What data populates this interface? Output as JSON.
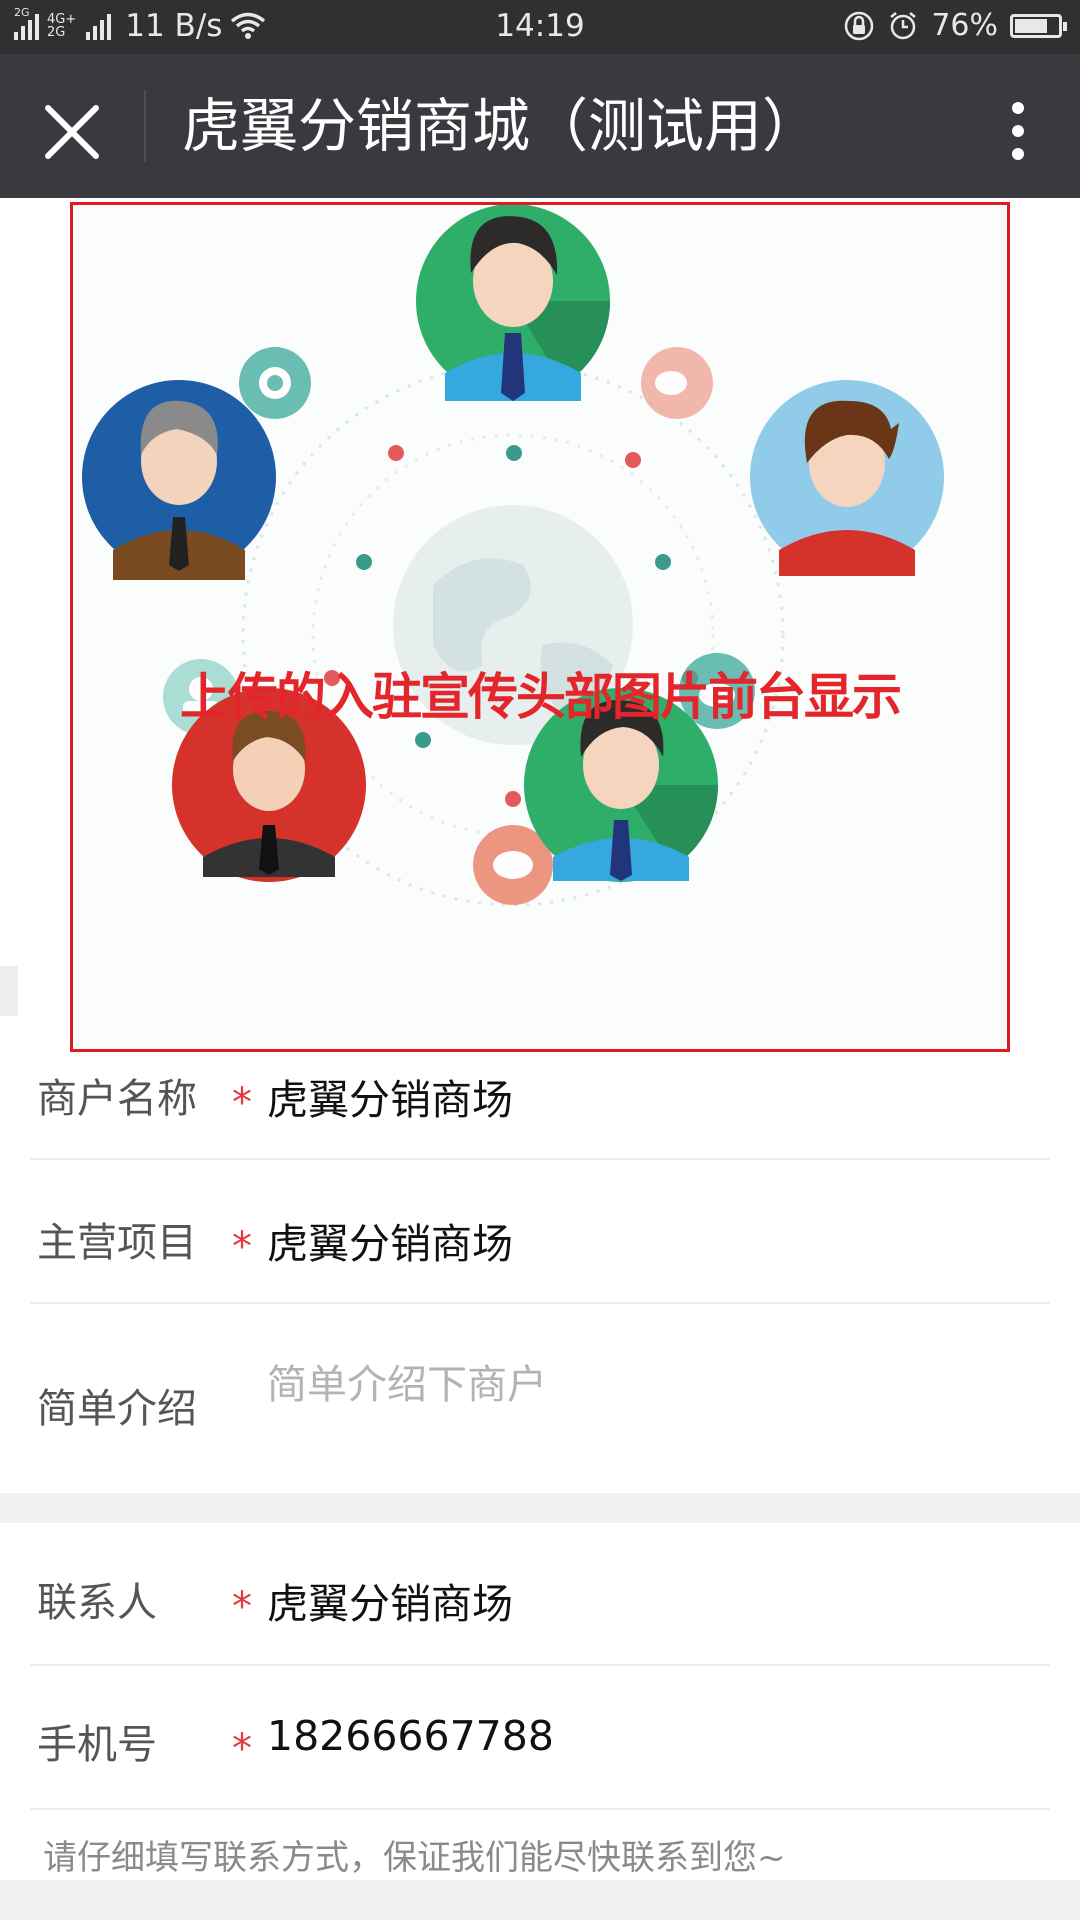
{
  "status_bar": {
    "net_top": "4G+",
    "net_bottom": "2G",
    "sig_left": "2G",
    "speed": "11 B/s",
    "time": "14:19",
    "battery": "76%",
    "battery_level": 0.76,
    "icons": [
      "signal-icon",
      "wifi-icon",
      "rotation-lock-icon",
      "alarm-icon",
      "battery-icon"
    ]
  },
  "nav": {
    "title": "虎翼分销商城（测试用）",
    "icons": [
      "close-icon",
      "more-icon"
    ]
  },
  "banner": {
    "caption": "上传的入驻宣传头部图片前台显示",
    "border_color": "#e11b22"
  },
  "form": {
    "merchant_name_label": "商户名称",
    "merchant_name_value": "虎翼分销商场",
    "main_business_label": "主营项目",
    "main_business_value": "虎翼分销商场",
    "intro_label": "简单介绍",
    "intro_placeholder": "简单介绍下商户",
    "contact_label": "联系人",
    "contact_value": "虎翼分销商场",
    "phone_label": "手机号",
    "phone_value": "18266667788",
    "required_mark": "*",
    "hint": "请仔细填写联系方式，保证我们能尽快联系到您~"
  },
  "colors": {
    "status_bar": "#2e3032",
    "nav_bar": "#393a3f",
    "required": "#e4393c",
    "caption": "#e3262b"
  }
}
